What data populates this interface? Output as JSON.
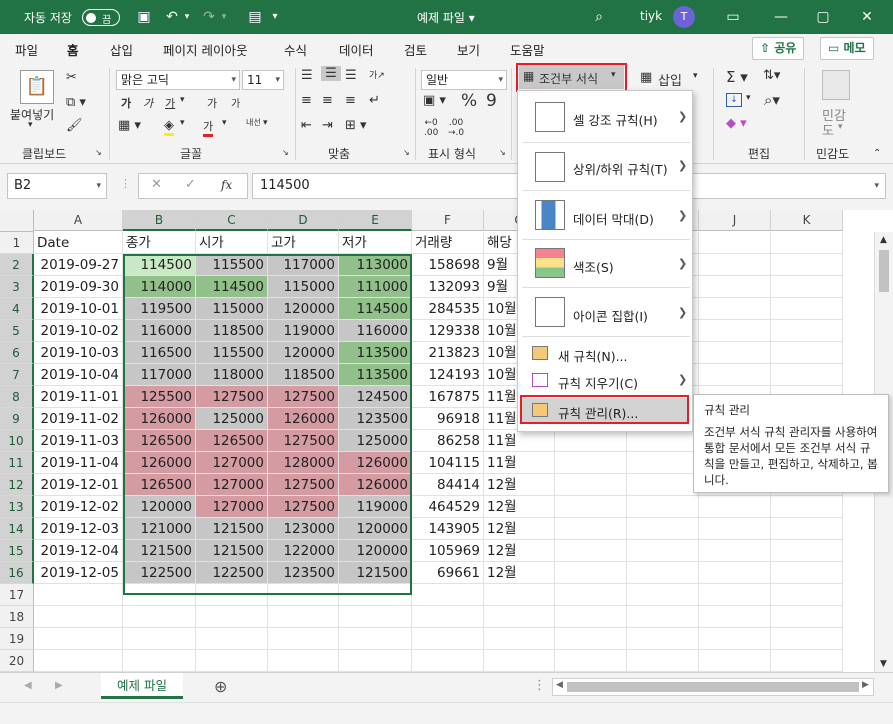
{
  "titlebar": {
    "autosave_label": "자동 저장",
    "autosave_state": "끔",
    "file_name": "예제 파일",
    "user_name": "tiyk",
    "avatar_initial": "T"
  },
  "tabs": [
    "파일",
    "홈",
    "삽입",
    "페이지 레이아웃",
    "수식",
    "데이터",
    "검토",
    "보기",
    "도움말"
  ],
  "share_label": "공유",
  "memo_label": "메모",
  "ribbon": {
    "clipboard": {
      "paste_label": "붙여넣기",
      "group_label": "클립보드"
    },
    "font": {
      "font_name": "맑은 고딕",
      "font_size": "11",
      "group_label": "글꼴",
      "bold": "가",
      "italic": "가",
      "underline": "가",
      "grow": "가",
      "shrink": "가",
      "phonetic": "내선"
    },
    "alignment": {
      "group_label": "맞춤"
    },
    "number": {
      "format": "일반",
      "group_label": "표시 형식"
    },
    "styles": {
      "conditional_label": "조건부 서식"
    },
    "cells": {
      "insert_label": "삽입"
    },
    "editing": {
      "group_label": "편집"
    },
    "sensitivity": {
      "label_top": "민감",
      "label_bottom": "도",
      "group_label": "민감도"
    }
  },
  "formula_bar": {
    "name_box": "B2",
    "formula": "114500",
    "fx": "fx"
  },
  "sheet": {
    "columns": [
      "A",
      "B",
      "C",
      "D",
      "E",
      "F",
      "G",
      "H",
      "I",
      "J",
      "K"
    ],
    "header_row": [
      "Date",
      "종가",
      "시가",
      "고가",
      "저가",
      "거래량",
      "해당"
    ],
    "rows": [
      [
        "2019-09-27",
        "114500",
        "115500",
        "117000",
        "113000",
        "158698",
        "9월"
      ],
      [
        "2019-09-30",
        "114000",
        "114500",
        "115000",
        "111000",
        "132093",
        "9월"
      ],
      [
        "2019-10-01",
        "119500",
        "115000",
        "120000",
        "114500",
        "284535",
        "10월"
      ],
      [
        "2019-10-02",
        "116000",
        "118500",
        "119000",
        "116000",
        "129338",
        "10월"
      ],
      [
        "2019-10-03",
        "116500",
        "115500",
        "120000",
        "113500",
        "213823",
        "10월"
      ],
      [
        "2019-10-04",
        "117000",
        "118000",
        "118500",
        "113500",
        "124193",
        "10월"
      ],
      [
        "2019-11-01",
        "125500",
        "127500",
        "127500",
        "124500",
        "167875",
        "11월"
      ],
      [
        "2019-11-02",
        "126000",
        "125000",
        "126000",
        "123500",
        "96918",
        "11월"
      ],
      [
        "2019-11-03",
        "126500",
        "126500",
        "127500",
        "125000",
        "86258",
        "11월"
      ],
      [
        "2019-11-04",
        "126000",
        "127000",
        "128000",
        "126000",
        "104115",
        "11월"
      ],
      [
        "2019-12-01",
        "126500",
        "127000",
        "127500",
        "126000",
        "84414",
        "12월"
      ],
      [
        "2019-12-02",
        "120000",
        "127000",
        "127500",
        "119000",
        "464529",
        "12월"
      ],
      [
        "2019-12-03",
        "121000",
        "121500",
        "123000",
        "120000",
        "143905",
        "12월"
      ],
      [
        "2019-12-04",
        "121500",
        "121500",
        "122000",
        "120000",
        "105969",
        "12월"
      ],
      [
        "2019-12-05",
        "122500",
        "122500",
        "123500",
        "121500",
        "69661",
        "12월"
      ]
    ],
    "fills": [
      [
        "grnl",
        "gr",
        "gr",
        "grn"
      ],
      [
        "grn",
        "grn",
        "gr",
        "grn"
      ],
      [
        "gr",
        "gr",
        "gr",
        "grn"
      ],
      [
        "gr",
        "gr",
        "gr",
        "gr"
      ],
      [
        "gr",
        "gr",
        "gr",
        "grn"
      ],
      [
        "gr",
        "gr",
        "gr",
        "grn"
      ],
      [
        "red",
        "red",
        "red",
        "gr"
      ],
      [
        "red",
        "gr",
        "red",
        "gr"
      ],
      [
        "red",
        "red",
        "red",
        "gr"
      ],
      [
        "red",
        "red",
        "red",
        "red"
      ],
      [
        "red",
        "red",
        "red",
        "red"
      ],
      [
        "gr",
        "red",
        "red",
        "gr"
      ],
      [
        "gr",
        "gr",
        "gr",
        "gr"
      ],
      [
        "gr",
        "gr",
        "gr",
        "gr"
      ],
      [
        "gr",
        "gr",
        "gr",
        "gr"
      ]
    ],
    "row_numbers": [
      "1",
      "2",
      "3",
      "4",
      "5",
      "6",
      "7",
      "8",
      "9",
      "10",
      "11",
      "12",
      "13",
      "14",
      "15",
      "16",
      "17",
      "18",
      "19",
      "20"
    ],
    "tab_name": "예제 파일"
  },
  "menu": {
    "items": [
      {
        "label": "셀 강조 규칙(H)"
      },
      {
        "label": "상위/하위 규칙(T)"
      },
      {
        "label": "데이터 막대(D)"
      },
      {
        "label": "색조(S)"
      },
      {
        "label": "아이콘 집합(I)"
      }
    ],
    "new_rule": "새 규칙(N)...",
    "clear_rules": "규칙 지우기(C)",
    "manage_rules": "규칙 관리(R)..."
  },
  "tooltip": {
    "title": "규칙 관리",
    "body": "조건부 서식 규칙 관리자를 사용하여 통합 문서에서 모든 조건부 서식 규칙을 만들고, 편집하고, 삭제하고, 봅니다."
  },
  "colors": {
    "accent": "#217346",
    "green_fill": "#92c08a",
    "red_fill": "#d49ca2",
    "gray_fill": "#c6c6c6",
    "highlight": "#e2202a"
  }
}
